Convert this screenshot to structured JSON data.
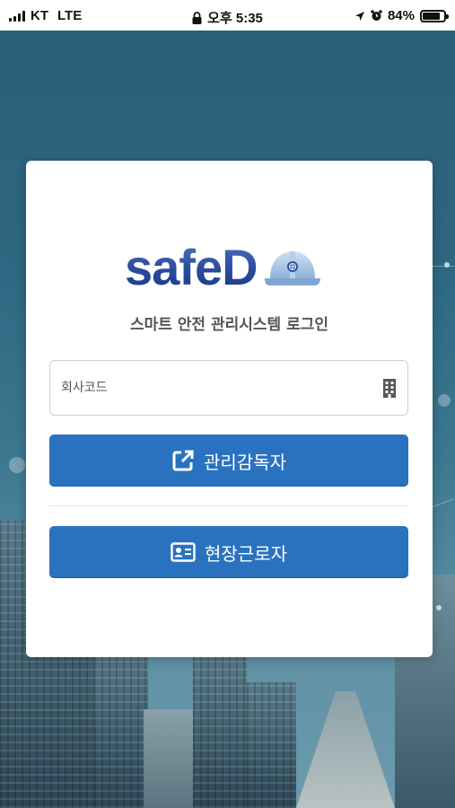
{
  "status_bar": {
    "carrier": "KT",
    "network": "LTE",
    "time": "오후 5:35",
    "battery": "84%",
    "battery_level": 0.84
  },
  "app": {
    "logo_text": "safeD",
    "subtitle": "스마트 안전 관리시스템 로그인"
  },
  "company_code": {
    "placeholder": "회사코드",
    "value": ""
  },
  "buttons": {
    "manager_label": "관리감독자",
    "worker_label": "현장근로자"
  },
  "colors": {
    "primary": "#2a72bf",
    "logo_blue": "#2b4ea0",
    "helmet": "#a9c6e6"
  },
  "icons": {
    "company": "building-icon",
    "manager": "external-link-icon",
    "worker": "id-card-icon",
    "logo": "helmet-icon"
  }
}
